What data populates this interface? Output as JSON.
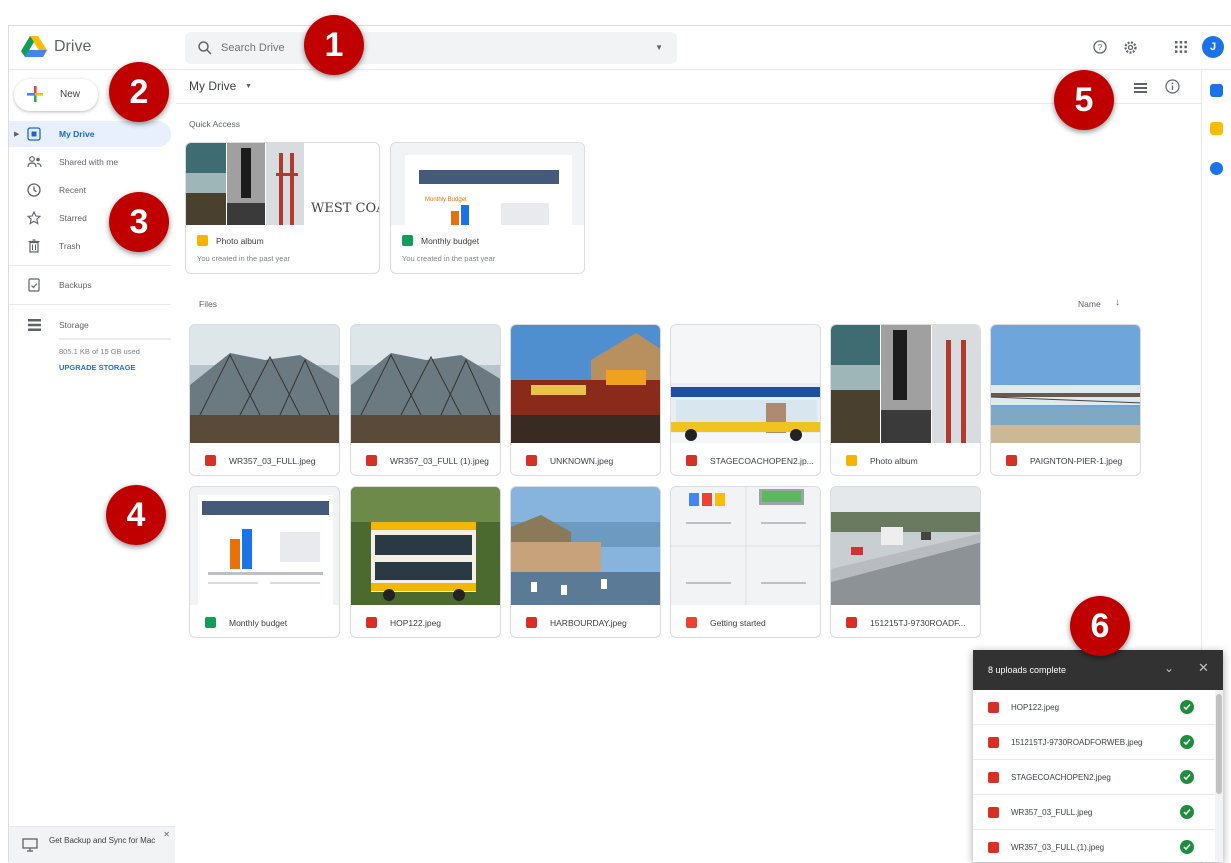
{
  "app": {
    "brand": "Drive"
  },
  "search": {
    "placeholder": "Search Drive"
  },
  "user": {
    "avatar_letter": "J"
  },
  "sidebar": {
    "new_label": "New",
    "items": [
      {
        "label": "My Drive",
        "icon": "my-drive-icon",
        "active": true
      },
      {
        "label": "Shared with me",
        "icon": "shared-icon"
      },
      {
        "label": "Recent",
        "icon": "clock-icon"
      },
      {
        "label": "Starred",
        "icon": "star-icon"
      },
      {
        "label": "Trash",
        "icon": "trash-icon"
      }
    ],
    "backups_label": "Backups",
    "storage_label": "Storage",
    "storage_used": "805.1 KB of 15 GB used",
    "upgrade_label": "UPGRADE STORAGE",
    "backup_banner": "Get Backup and Sync for Mac"
  },
  "main": {
    "title": "My Drive",
    "quick_access_label": "Quick Access",
    "quick_access": [
      {
        "name": "Photo album",
        "sub": "You created in the past year",
        "type": "slides",
        "thumb_text": "WEST COAST ROAD TRIP"
      },
      {
        "name": "Monthly budget",
        "sub": "You created in the past year",
        "type": "sheets",
        "thumb_text": "Monthly Budget"
      }
    ],
    "files_label": "Files",
    "sort_label": "Name",
    "files": [
      {
        "name": "WR357_03_FULL.jpeg",
        "type": "image"
      },
      {
        "name": "WR357_03_FULL (1).jpeg",
        "type": "image"
      },
      {
        "name": "UNKNOWN.jpeg",
        "type": "image"
      },
      {
        "name": "STAGECOACHOPEN2.jp...",
        "type": "image"
      },
      {
        "name": "Photo album",
        "type": "slides"
      },
      {
        "name": "PAIGNTON-PIER-1.jpeg",
        "type": "image"
      },
      {
        "name": "Monthly budget",
        "type": "sheets"
      },
      {
        "name": "HOP122.jpeg",
        "type": "image"
      },
      {
        "name": "HARBOURDAY.jpeg",
        "type": "image"
      },
      {
        "name": "Getting started",
        "type": "pdf"
      },
      {
        "name": "151215TJ-9730ROADF...",
        "type": "image"
      }
    ]
  },
  "uploads": {
    "title": "8 uploads complete",
    "items": [
      "HOP122.jpeg",
      "151215TJ-9730ROADFORWEB.jpeg",
      "STAGECOACHOPEN2.jpeg",
      "WR357_03_FULL.jpeg",
      "WR357_03_FULL (1).jpeg"
    ]
  },
  "badges": [
    "1",
    "2",
    "3",
    "4",
    "5",
    "6"
  ],
  "colors": {
    "accent": "#1a73e8",
    "badge": "#c00000",
    "active_nav_bg": "#e8f0fe"
  }
}
